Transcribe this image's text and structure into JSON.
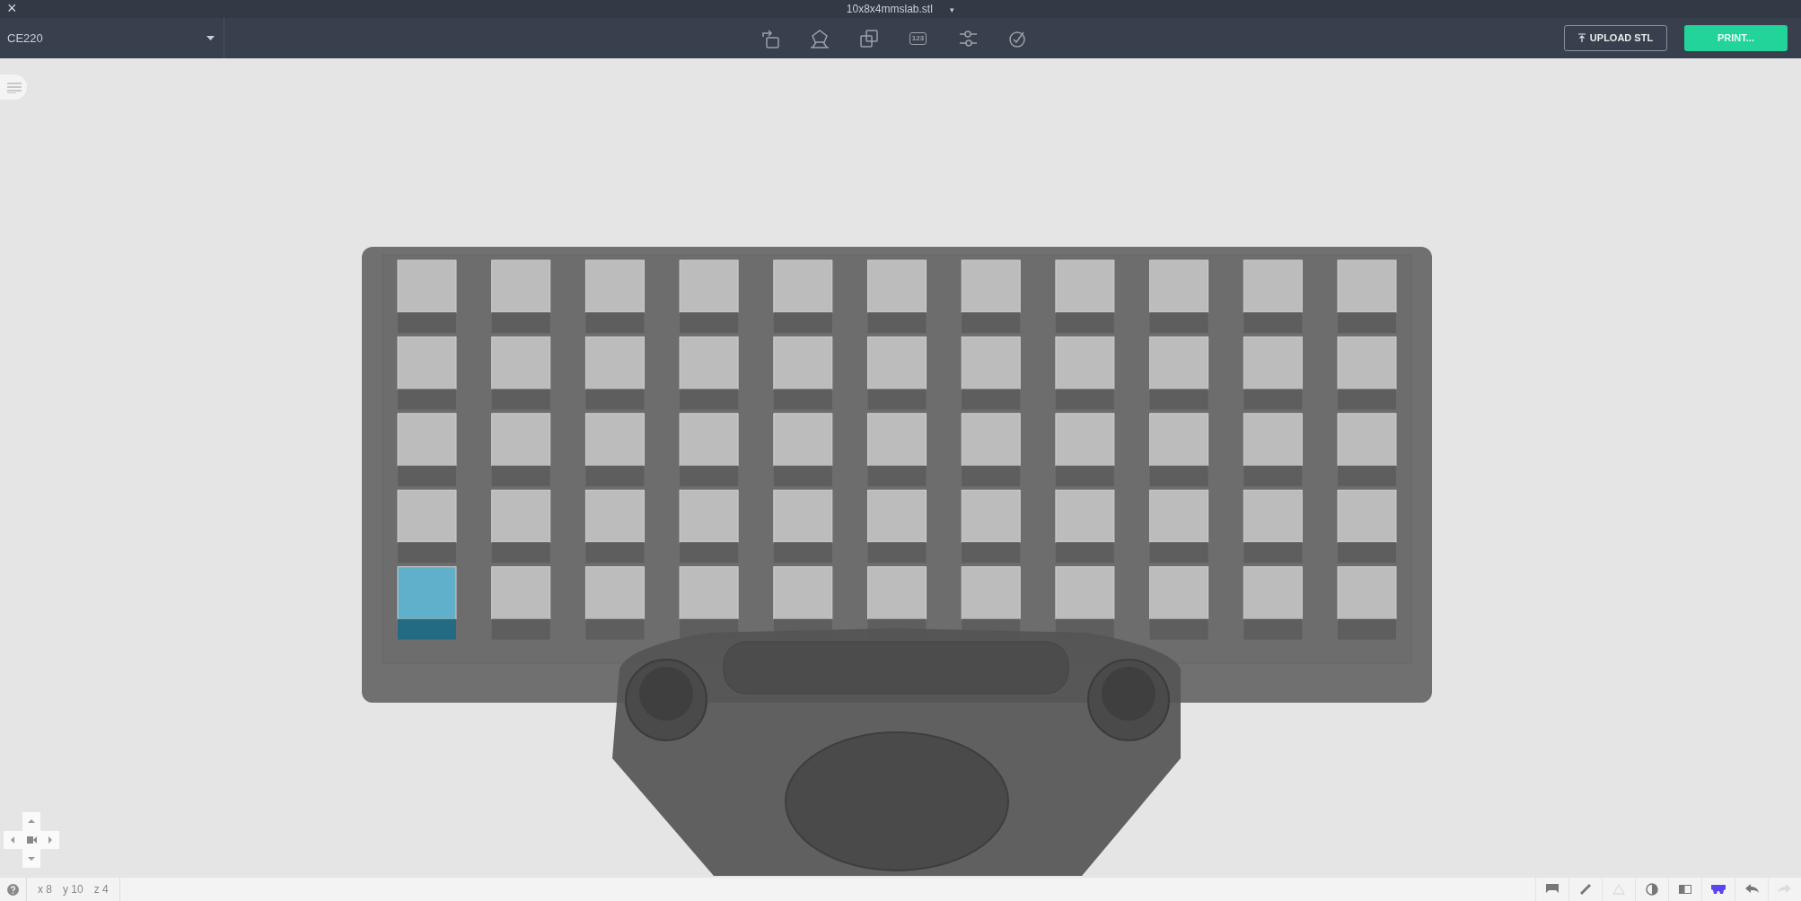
{
  "window": {
    "close": "×",
    "title": "10x8x4mmslab.stl",
    "title_menu": "▾"
  },
  "toolbar": {
    "printer": "CE220",
    "tools": [
      {
        "kind": "rotate"
      },
      {
        "kind": "place-face"
      },
      {
        "kind": "duplicate"
      },
      {
        "kind": "numbers",
        "label": "123"
      },
      {
        "kind": "settings"
      },
      {
        "kind": "check"
      }
    ],
    "upload": "UPLOAD STL",
    "print": "PRINT..."
  },
  "model": {
    "wells": [
      [
        {
          "selected": false
        },
        {
          "selected": false
        },
        {
          "selected": false
        },
        {
          "selected": false
        },
        {
          "selected": false
        },
        {
          "selected": false
        },
        {
          "selected": false
        },
        {
          "selected": false
        },
        {
          "selected": false
        },
        {
          "selected": false
        },
        {
          "selected": false
        }
      ],
      [
        {
          "selected": false
        },
        {
          "selected": false
        },
        {
          "selected": false
        },
        {
          "selected": false
        },
        {
          "selected": false
        },
        {
          "selected": false
        },
        {
          "selected": false
        },
        {
          "selected": false
        },
        {
          "selected": false
        },
        {
          "selected": false
        },
        {
          "selected": false
        }
      ],
      [
        {
          "selected": false
        },
        {
          "selected": false
        },
        {
          "selected": false
        },
        {
          "selected": false
        },
        {
          "selected": false
        },
        {
          "selected": false
        },
        {
          "selected": false
        },
        {
          "selected": false
        },
        {
          "selected": false
        },
        {
          "selected": false
        },
        {
          "selected": false
        }
      ],
      [
        {
          "selected": false
        },
        {
          "selected": false
        },
        {
          "selected": false
        },
        {
          "selected": false
        },
        {
          "selected": false
        },
        {
          "selected": false
        },
        {
          "selected": false
        },
        {
          "selected": false
        },
        {
          "selected": false
        },
        {
          "selected": false
        },
        {
          "selected": false
        }
      ],
      [
        {
          "selected": true
        },
        {
          "selected": false
        },
        {
          "selected": false
        },
        {
          "selected": false
        },
        {
          "selected": false
        },
        {
          "selected": false
        },
        {
          "selected": false
        },
        {
          "selected": false
        },
        {
          "selected": false
        },
        {
          "selected": false
        },
        {
          "selected": false
        }
      ]
    ]
  },
  "status_bar": {
    "coords": [
      "x 8",
      "y 10",
      "z 4"
    ],
    "tools": [
      {
        "kind": "tray",
        "disabled": false,
        "selected": false
      },
      {
        "kind": "ruler",
        "disabled": false,
        "selected": false
      },
      {
        "kind": "triangle",
        "disabled": true,
        "selected": false
      },
      {
        "kind": "contrast",
        "disabled": false,
        "selected": false
      },
      {
        "kind": "panel",
        "disabled": false,
        "selected": false
      },
      {
        "kind": "holder",
        "disabled": false,
        "selected": true
      },
      {
        "kind": "undo",
        "disabled": false,
        "selected": false
      },
      {
        "kind": "redo",
        "disabled": true,
        "selected": false
      }
    ]
  }
}
